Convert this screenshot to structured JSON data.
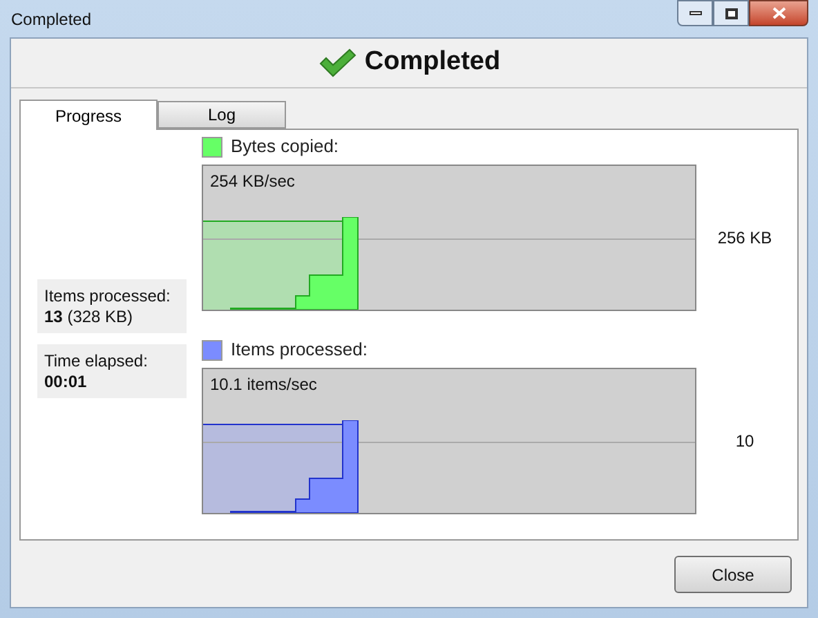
{
  "window": {
    "title": "Completed"
  },
  "header": {
    "title": "Completed"
  },
  "tabs": [
    {
      "label": "Progress",
      "selected": true
    },
    {
      "label": "Log",
      "selected": false
    }
  ],
  "stats": [
    {
      "label": "Items processed:",
      "value": "**13** (328 KB)"
    },
    {
      "label": "Time elapsed:",
      "value": "**00:01**"
    }
  ],
  "graphs": [
    {
      "legend": "Bytes copied:",
      "color": "#66ff66",
      "rate": "254 KB/sec",
      "scale": "256 KB"
    },
    {
      "legend": "Items processed:",
      "color": "#7b8cff",
      "rate": "10.1 items/sec",
      "scale": "10"
    }
  ],
  "buttons": [
    {
      "label": "Close"
    }
  ]
}
